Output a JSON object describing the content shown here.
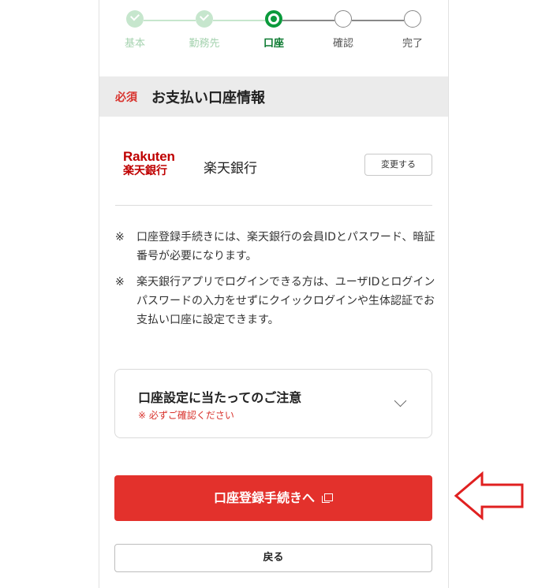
{
  "stepper": {
    "steps": [
      {
        "label": "基本",
        "state": "done"
      },
      {
        "label": "勤務先",
        "state": "done"
      },
      {
        "label": "口座",
        "state": "current"
      },
      {
        "label": "確認",
        "state": "todo"
      },
      {
        "label": "完了",
        "state": "todo"
      }
    ]
  },
  "section": {
    "required_badge": "必須",
    "title": "お支払い口座情報"
  },
  "bank": {
    "logo_en": "Rakuten",
    "logo_jp": "楽天銀行",
    "name": "楽天銀行",
    "change_button": "変更する"
  },
  "notes": [
    {
      "mark": "※",
      "text": "口座登録手続きには、楽天銀行の会員IDとパスワード、暗証番号が必要になります。"
    },
    {
      "mark": "※",
      "text": "楽天銀行アプリでログインできる方は、ユーザIDとログインパスワードの入力をせずにクイックログインや生体認証でお支払い口座に設定できます。"
    }
  ],
  "caution": {
    "title": "口座設定に当たってのご注意",
    "subtitle": "※ 必ずご確認ください"
  },
  "actions": {
    "primary_label": "口座登録手続きへ",
    "back_label": "戻る"
  },
  "colors": {
    "accent_red": "#e3312c",
    "step_green": "#0b9a3c",
    "step_done": "#c6e6cd",
    "arrow_red": "#e02020"
  },
  "icons": {
    "external": "external-window-icon",
    "chevron": "chevron-down-icon",
    "arrow": "left-arrow-icon"
  }
}
